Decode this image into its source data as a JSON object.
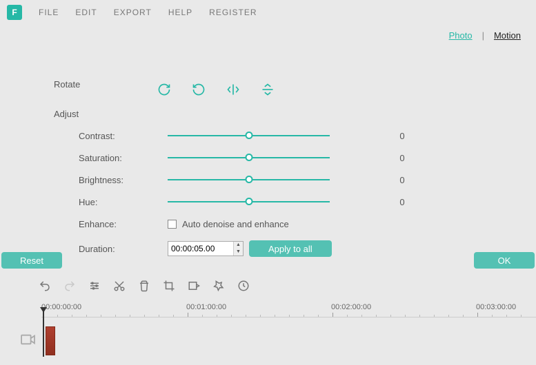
{
  "app": {
    "logo_letter": "F"
  },
  "menu": {
    "file": "FILE",
    "edit": "EDIT",
    "export": "EXPORT",
    "help": "HELP",
    "register": "REGISTER"
  },
  "tabs": {
    "photo": "Photo",
    "sep": "|",
    "motion": "Motion"
  },
  "rotate": {
    "label": "Rotate"
  },
  "adjust": {
    "label": "Adjust",
    "contrast": {
      "label": "Contrast:",
      "value": "0"
    },
    "saturation": {
      "label": "Saturation:",
      "value": "0"
    },
    "brightness": {
      "label": "Brightness:",
      "value": "0"
    },
    "hue": {
      "label": "Hue:",
      "value": "0"
    },
    "enhance": {
      "label": "Enhance:",
      "checkbox_text": "Auto denoise and enhance"
    },
    "duration": {
      "label": "Duration:",
      "value": "00:00:05.00",
      "apply_label": "Apply to all"
    }
  },
  "buttons": {
    "reset": "Reset",
    "ok": "OK"
  },
  "timeline": {
    "labels": {
      "t0": "00:00:00:00",
      "t1": "00:01:00:00",
      "t2": "00:02:00:00",
      "t3": "00:03:00:00"
    }
  }
}
